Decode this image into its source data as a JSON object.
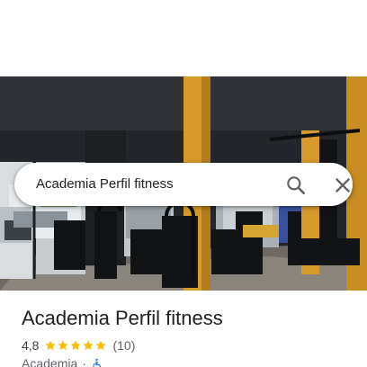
{
  "search": {
    "query": "Academia Perfil fitness",
    "search_icon": "search-icon",
    "close_icon": "close-icon"
  },
  "photo": {
    "subject": "gym-interior-photo"
  },
  "place": {
    "title": "Academia Perfil fitness",
    "rating": "4,8",
    "stars": 5,
    "reviews": "(10)",
    "category": "Academia",
    "separator": "·",
    "accessibility_icon": "wheelchair-accessible-icon"
  },
  "colors": {
    "star": "#fbbc04",
    "accessibility": "#1a73e8",
    "text_primary": "#202124",
    "text_secondary": "#5f6368"
  }
}
